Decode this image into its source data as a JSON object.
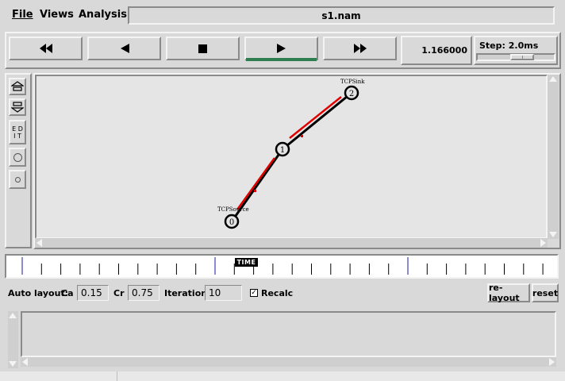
{
  "menu": {
    "file": "File",
    "views": "Views",
    "analysis": "Analysis"
  },
  "title": "s1.nam",
  "controls": {
    "rewind": "rewind-icon",
    "back": "back-icon",
    "stop": "stop-icon",
    "play": "play-icon",
    "fastforward": "fastforward-icon",
    "active": "play",
    "active_color": "#2e7d4f"
  },
  "time": "1.166000",
  "step": {
    "label": "Step: 2.0ms",
    "slider_fraction": 0.62
  },
  "tools": {
    "edit": "E D\nI T"
  },
  "graph": {
    "nodes": [
      {
        "id": "0",
        "label": "TCPSource"
      },
      {
        "id": "1",
        "label": ""
      },
      {
        "id": "2",
        "label": "TCPSink"
      }
    ],
    "link_color": "#000000",
    "packet_color": "#e00000"
  },
  "timeline": {
    "label": "TIME"
  },
  "autolayout": {
    "label": "Auto layout:",
    "ca_label": "Ca",
    "ca_value": "0.15",
    "cr_label": "Cr",
    "cr_value": "0.75",
    "iter_label": "Iterations",
    "iter_value": "10",
    "recalc_label": "Recalc",
    "recalc_checked": true,
    "relayout_btn": "re-layout",
    "reset_btn": "reset"
  }
}
